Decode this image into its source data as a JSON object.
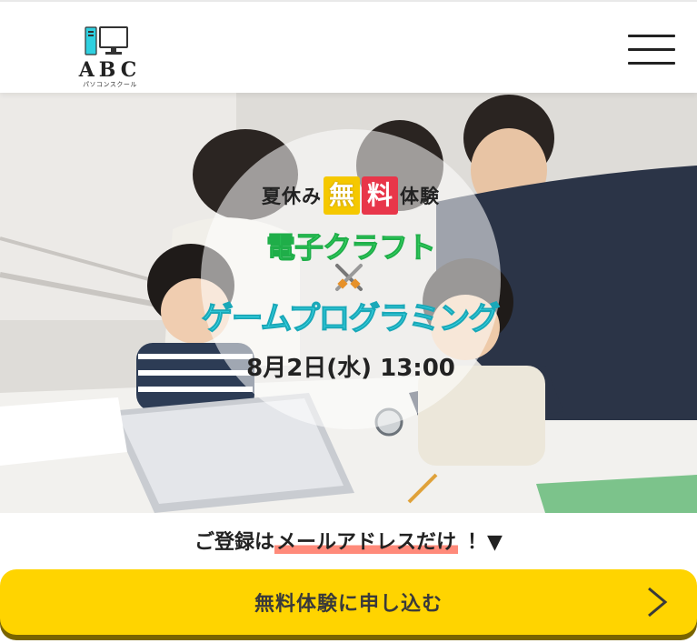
{
  "header": {
    "logo_text": "ABC",
    "logo_sub": "パソコンスクール",
    "menu_icon": "hamburger-menu-icon"
  },
  "hero": {
    "line1_prefix": "夏休み",
    "badge1": "無",
    "badge2": "料",
    "line1_suffix": "体験",
    "line2": "電子クラフト",
    "cross_icon": "crossed-swords-icon",
    "line3": "ゲームプログラミング",
    "line4": "8月2日(水) 13:00",
    "colors": {
      "badge_yellow": "#f5c800",
      "badge_red": "#e8364a",
      "green_text": "#3ee06a",
      "cyan_text": "#3ad7e6"
    }
  },
  "registration": {
    "prefix": "ご登録は",
    "highlight": "メールアドレスだけ",
    "suffix": "！▼"
  },
  "cta": {
    "label": "無料体験に申し込む",
    "arrow_icon": "chevron-right-icon",
    "color": "#ffd400"
  }
}
